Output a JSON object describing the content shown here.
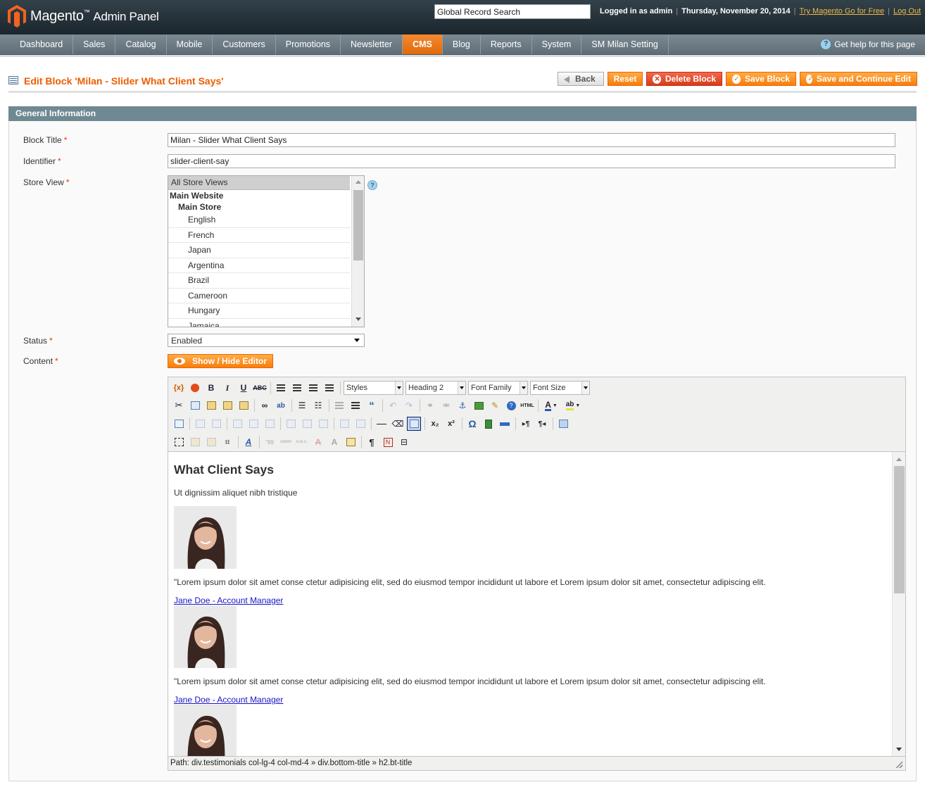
{
  "header": {
    "logo_brand": "Magento",
    "logo_sub": "Admin Panel",
    "search_value": "Global Record Search",
    "logged_in": "Logged in as admin",
    "date": "Thursday, November 20, 2014",
    "try_link": "Try Magento Go for Free",
    "logout": "Log Out"
  },
  "nav": {
    "items": [
      "Dashboard",
      "Sales",
      "Catalog",
      "Mobile",
      "Customers",
      "Promotions",
      "Newsletter",
      "CMS",
      "Blog",
      "Reports",
      "System",
      "SM Milan Setting"
    ],
    "active": "CMS",
    "help": "Get help for this page"
  },
  "page": {
    "title": "Edit Block 'Milan - Slider What Client Says'",
    "buttons": {
      "back": "Back",
      "reset": "Reset",
      "delete": "Delete Block",
      "save": "Save Block",
      "save_continue": "Save and Continue Edit"
    }
  },
  "section": {
    "title": "General Information"
  },
  "form": {
    "block_title_label": "Block Title",
    "block_title_value": "Milan - Slider What Client Says",
    "identifier_label": "Identifier",
    "identifier_value": "slider-client-say",
    "store_view_label": "Store View",
    "store_view_options": {
      "selected": "All Store Views",
      "website": "Main Website",
      "store": "Main Store",
      "views": [
        "English",
        "French",
        "Japan",
        "Argentina",
        "Brazil",
        "Cameroon",
        "Hungary",
        "Jamaica"
      ]
    },
    "status_label": "Status",
    "status_value": "Enabled",
    "content_label": "Content",
    "toggle_editor": "Show / Hide Editor",
    "required_mark": "*"
  },
  "editor": {
    "toolbar": {
      "styles": "Styles",
      "format": "Heading 2",
      "font_family": "Font Family",
      "font_size": "Font Size"
    },
    "content": {
      "heading": "What Client Says",
      "subtitle": "Ut dignissim aliquet nibh tristique",
      "testimonials": [
        {
          "quote": "\"Lorem ipsum dolor sit amet conse ctetur adipisicing elit, sed do eiusmod tempor incididunt ut labore et Lorem ipsum dolor sit amet, consectetur adipiscing elit.",
          "author": "Jane Doe - Account Manager"
        },
        {
          "quote": "\"Lorem ipsum dolor sit amet conse ctetur adipisicing elit, sed do eiusmod tempor incididunt ut labore et Lorem ipsum dolor sit amet, consectetur adipiscing elit.",
          "author": "Jane Doe - Account Manager"
        }
      ]
    },
    "path": "Path: div.testimonials col-lg-4 col-md-4 » div.bottom-title » h2.bt-title"
  },
  "colors": {
    "accent": "#eb5e00",
    "header_bg": "#1b262d",
    "nav_bg": "#6b7982",
    "section_bg": "#6f8992"
  }
}
